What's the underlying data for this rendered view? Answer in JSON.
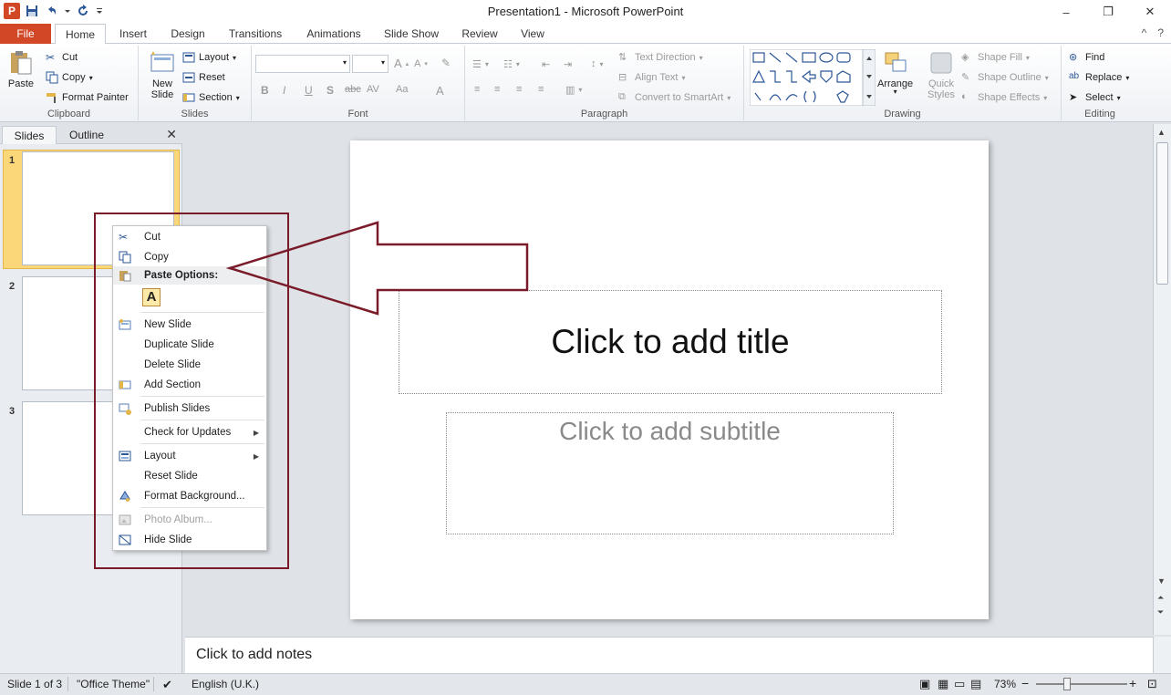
{
  "window": {
    "title": "Presentation1  -  Microsoft PowerPoint",
    "app_icon_letter": "P",
    "min_label": "–",
    "restore_label": "❐",
    "close_label": "✕"
  },
  "tabs": {
    "file": "File",
    "home": "Home",
    "insert": "Insert",
    "design": "Design",
    "transitions": "Transitions",
    "animations": "Animations",
    "slideshow": "Slide Show",
    "review": "Review",
    "view": "View",
    "collapse": "^",
    "help": "?"
  },
  "ribbon": {
    "clipboard": {
      "label": "Clipboard",
      "paste": "Paste",
      "cut": "Cut",
      "copy": "Copy",
      "format_painter": "Format Painter"
    },
    "slides": {
      "label": "Slides",
      "new_slide": "New Slide",
      "layout": "Layout",
      "reset": "Reset",
      "section": "Section"
    },
    "font": {
      "label": "Font",
      "bold": "B",
      "italic": "I",
      "underline": "U",
      "shadow": "S",
      "strike": "abc",
      "spacing": "AV",
      "case": "Aa",
      "color": "A"
    },
    "paragraph": {
      "label": "Paragraph",
      "text_direction": "Text Direction",
      "align_text": "Align Text",
      "convert_smartart": "Convert to SmartArt"
    },
    "drawing": {
      "label": "Drawing",
      "arrange": "Arrange",
      "quick_styles": "Quick Styles",
      "shape_fill": "Shape Fill",
      "shape_outline": "Shape Outline",
      "shape_effects": "Shape Effects"
    },
    "editing": {
      "label": "Editing",
      "find": "Find",
      "replace": "Replace",
      "select": "Select"
    }
  },
  "slide_pane": {
    "tab_slides": "Slides",
    "tab_outline": "Outline",
    "close": "✕",
    "thumbs": [
      "1",
      "2",
      "3"
    ]
  },
  "slide": {
    "title_placeholder": "Click to add title",
    "subtitle_placeholder": "Click to add subtitle"
  },
  "notes": {
    "placeholder": "Click to add notes"
  },
  "context_menu": {
    "cut": "Cut",
    "copy": "Copy",
    "paste_options": "Paste Options:",
    "paste_keep_text": "A",
    "new_slide": "New Slide",
    "duplicate_slide": "Duplicate Slide",
    "delete_slide": "Delete Slide",
    "add_section": "Add Section",
    "publish_slides": "Publish Slides",
    "check_updates": "Check for Updates",
    "layout": "Layout",
    "reset_slide": "Reset Slide",
    "format_background": "Format Background...",
    "photo_album": "Photo Album...",
    "hide_slide": "Hide Slide"
  },
  "status": {
    "slide_count": "Slide 1 of 3",
    "theme": "\"Office Theme\"",
    "language": "English (U.K.)",
    "zoom": "73%",
    "zoom_minus": "−",
    "zoom_plus": "+"
  },
  "colors": {
    "file_tab": "#d24726",
    "annotation": "#7a1b2a",
    "selected_thumb": "#fcd77a"
  }
}
